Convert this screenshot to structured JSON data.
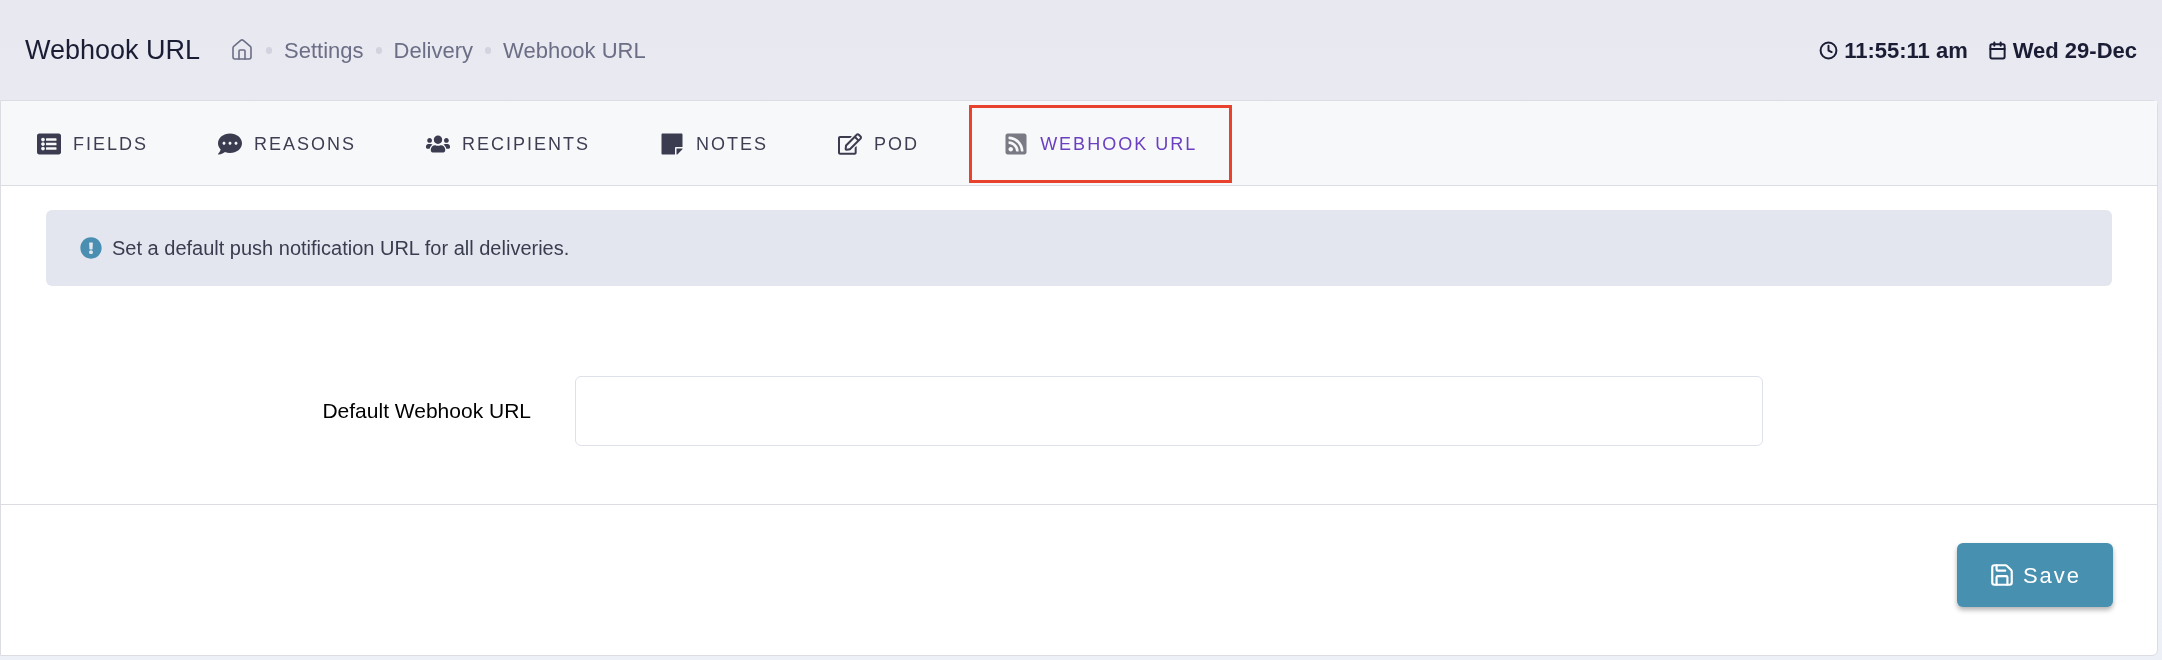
{
  "header": {
    "title": "Webhook URL",
    "breadcrumbs": [
      "Settings",
      "Delivery",
      "Webhook URL"
    ],
    "time": "11:55:11 am",
    "date": "Wed 29-Dec"
  },
  "tabs": [
    {
      "label": "FIELDS",
      "selected": false
    },
    {
      "label": "REASONS",
      "selected": false
    },
    {
      "label": "RECIPIENTS",
      "selected": false
    },
    {
      "label": "NOTES",
      "selected": false
    },
    {
      "label": "POD",
      "selected": false
    },
    {
      "label": "WEBHOOK URL",
      "selected": true
    }
  ],
  "alert": {
    "text": "Set a default push notification URL for all deliveries."
  },
  "form": {
    "label": "Default Webhook URL"
  },
  "buttons": {
    "save": "Save"
  }
}
